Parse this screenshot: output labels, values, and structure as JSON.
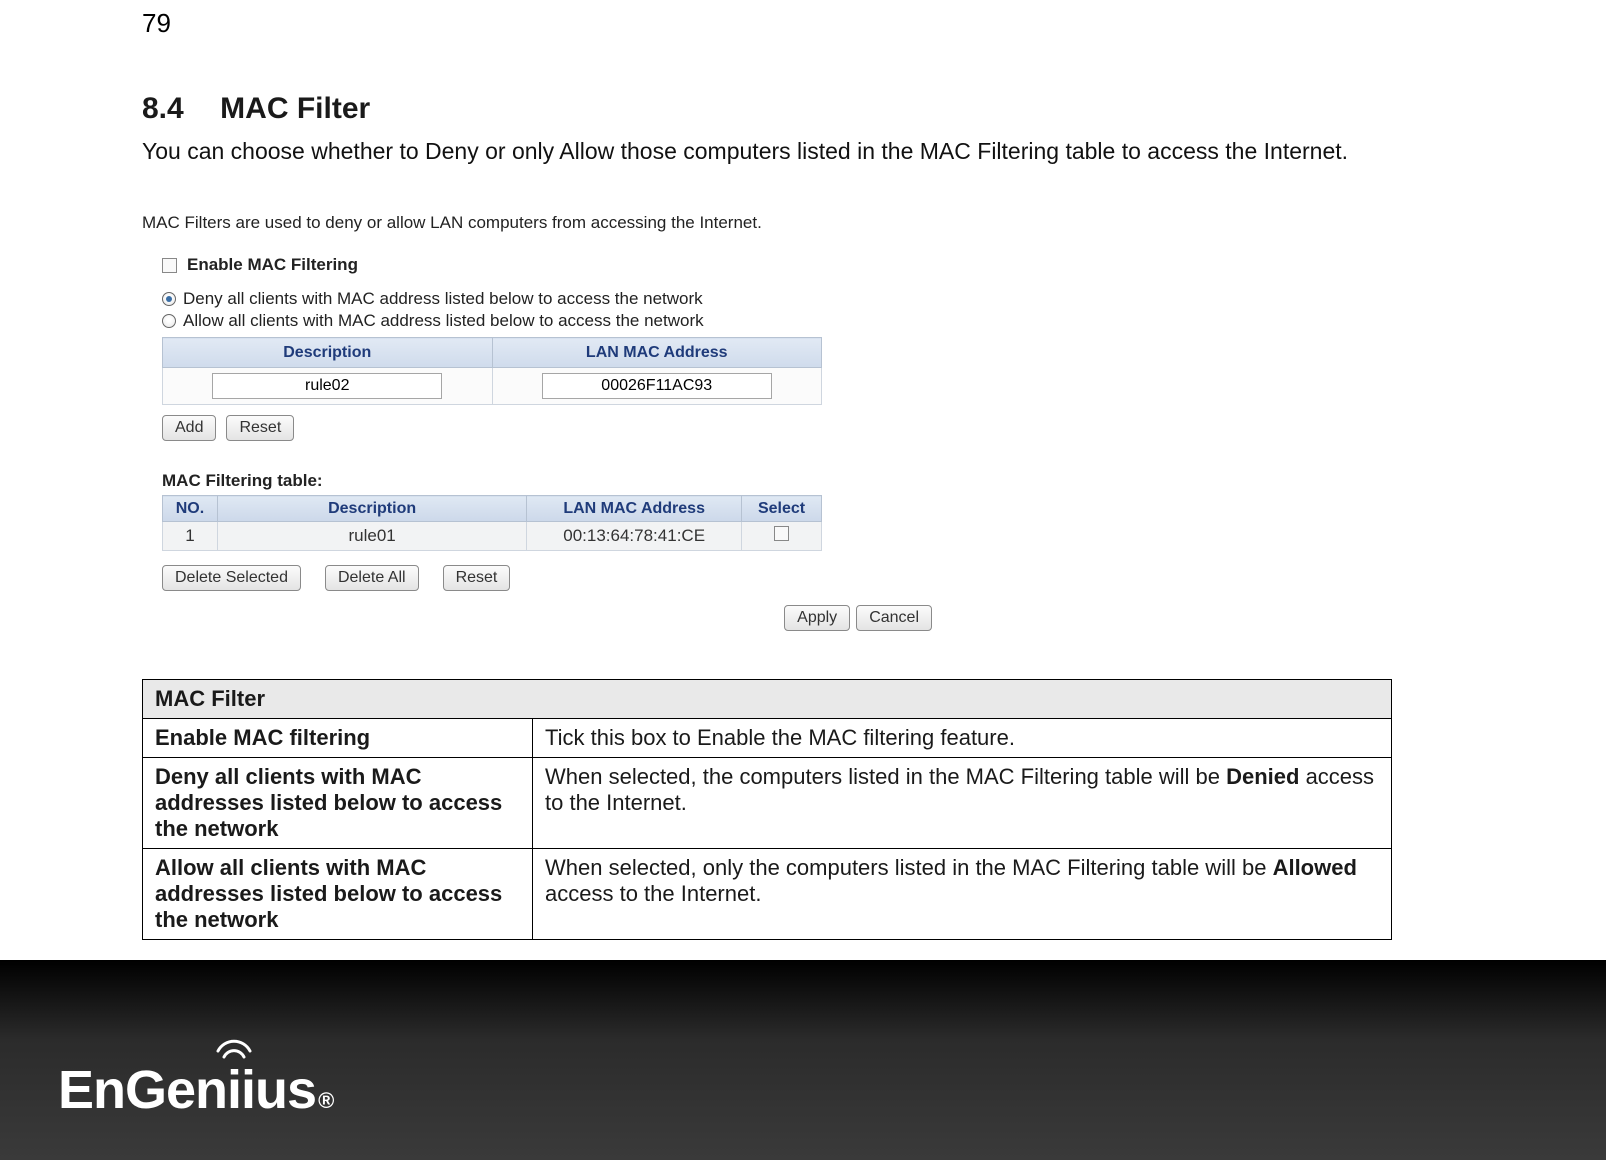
{
  "page_number": "79",
  "section": {
    "number": "8.4",
    "title": "MAC Filter"
  },
  "subtitle": "You can choose whether to Deny or only Allow those computers listed in the MAC Filtering table to access the Internet.",
  "mac_filter_panel": {
    "intro": "MAC Filters are used to deny or allow LAN computers from accessing the Internet.",
    "enable_label": "Enable MAC Filtering",
    "radio_deny": "Deny all clients with MAC address listed below to access the network",
    "radio_allow": "Allow all clients with MAC address listed below to access the network",
    "input_headers": {
      "desc": "Description",
      "mac": "LAN MAC Address"
    },
    "input_row": {
      "desc_value": "rule02",
      "mac_value": "00026F11AC93"
    },
    "buttons": {
      "add": "Add",
      "reset": "Reset"
    },
    "table_label": "MAC Filtering table:",
    "list_headers": {
      "no": "NO.",
      "desc": "Description",
      "mac": "LAN MAC Address",
      "select": "Select"
    },
    "list_rows": [
      {
        "no": "1",
        "desc": "rule01",
        "mac": "00:13:64:78:41:CE"
      }
    ],
    "buttons2": {
      "delete_selected": "Delete Selected",
      "delete_all": "Delete All",
      "reset": "Reset"
    },
    "bottom": {
      "apply": "Apply",
      "cancel": "Cancel"
    }
  },
  "info_table": {
    "header": "MAC Filter",
    "rows": [
      {
        "label": "Enable MAC filtering",
        "desc_parts": [
          "Tick this box to Enable the MAC filtering feature."
        ]
      },
      {
        "label": "Deny all clients with MAC addresses listed below to access the network",
        "desc_parts": [
          "When selected, the computers listed in the MAC Filtering table will be ",
          "Denied",
          " access to the Internet."
        ]
      },
      {
        "label": "Allow all clients with MAC addresses listed below to access the network",
        "desc_parts": [
          "When selected, only the computers listed in the MAC Filtering table will be ",
          "Allowed",
          " access to the Internet."
        ]
      }
    ]
  },
  "logo_text": {
    "part1": "EnGen",
    "part2": "ius"
  }
}
